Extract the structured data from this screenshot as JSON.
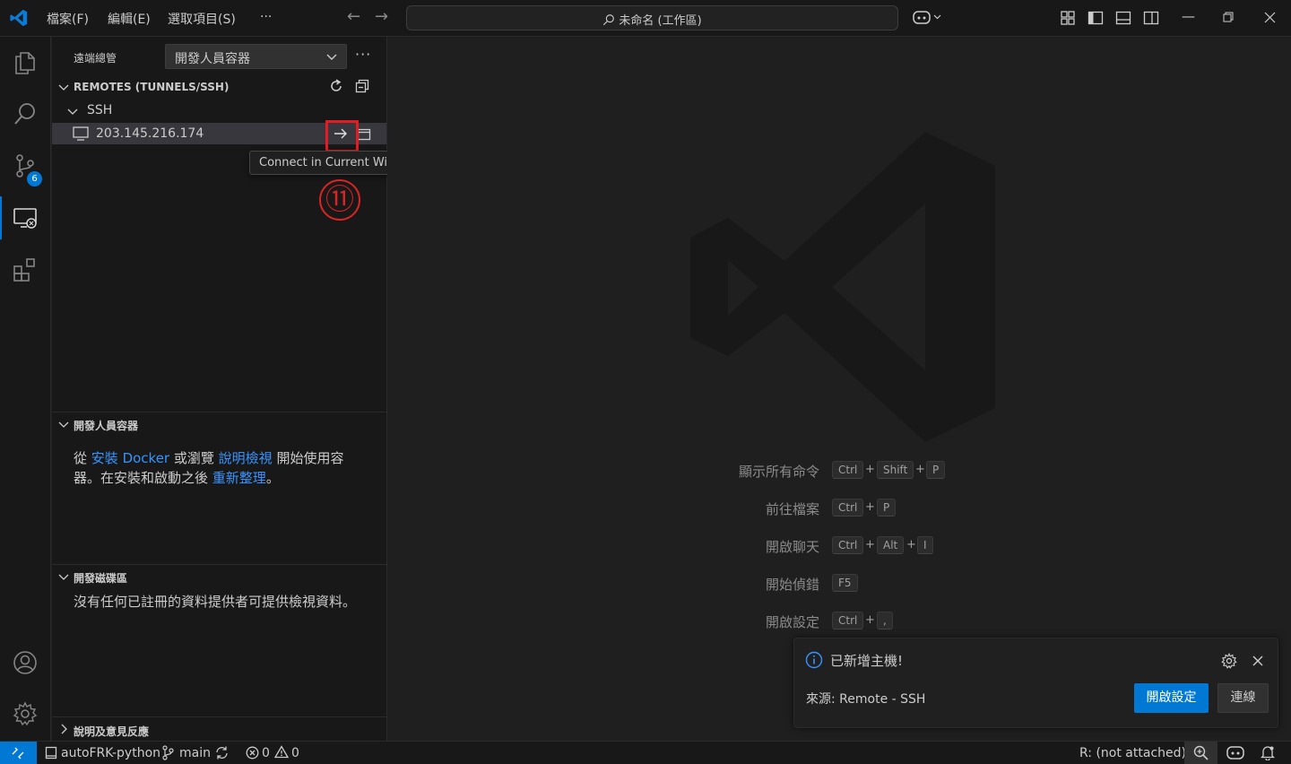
{
  "titlebar": {
    "menus": [
      "檔案(F)",
      "編輯(E)",
      "選取項目(S)",
      "···"
    ],
    "search_text": "未命名 (工作區)"
  },
  "sidebar": {
    "title": "遠端總管",
    "dropdown_value": "開發人員容器",
    "remotes_header": "REMOTES (TUNNELS/SSH)",
    "ssh_label": "SSH",
    "host": "203.145.216.174",
    "tooltip": "Connect in Current Window...",
    "annotation": "⑪",
    "dev_containers_header": "開發人員容器",
    "dev_text_1": "從",
    "dev_link_docker": "安裝 Docker",
    "dev_text_2": "或瀏覽",
    "dev_link_help": "說明檢視",
    "dev_text_3": "開始使用容",
    "dev_text_4": "器。在安裝和啟動之後",
    "dev_link_refresh": "重新整理",
    "dev_text_5": "。",
    "dev_volumes_header": "開發磁碟區",
    "dev_volumes_text": "沒有任何已註冊的資料提供者可提供檢視資料。",
    "help_header": "說明及意見反應"
  },
  "activity": {
    "scm_badge": "6"
  },
  "editor": {
    "shortcuts": [
      {
        "label": "顯示所有命令",
        "keys": [
          "Ctrl",
          "Shift",
          "P"
        ]
      },
      {
        "label": "前往檔案",
        "keys": [
          "Ctrl",
          "P"
        ]
      },
      {
        "label": "開啟聊天",
        "keys": [
          "Ctrl",
          "Alt",
          "I"
        ]
      },
      {
        "label": "開始偵錯",
        "keys": [
          "F5"
        ]
      },
      {
        "label": "開啟設定",
        "keys": [
          "Ctrl",
          ","
        ]
      }
    ]
  },
  "notification": {
    "message": "已新增主機!",
    "source": "來源: Remote - SSH",
    "primary_button": "開啟設定",
    "secondary_button": "連線"
  },
  "statusbar": {
    "project": "autoFRK-python",
    "branch": "main",
    "errors": "0",
    "warnings": "0",
    "remote_status": "R: (not attached)"
  },
  "colors": {
    "accent": "#0078d4",
    "link": "#3794ff",
    "annotation_red": "#e31b23"
  }
}
